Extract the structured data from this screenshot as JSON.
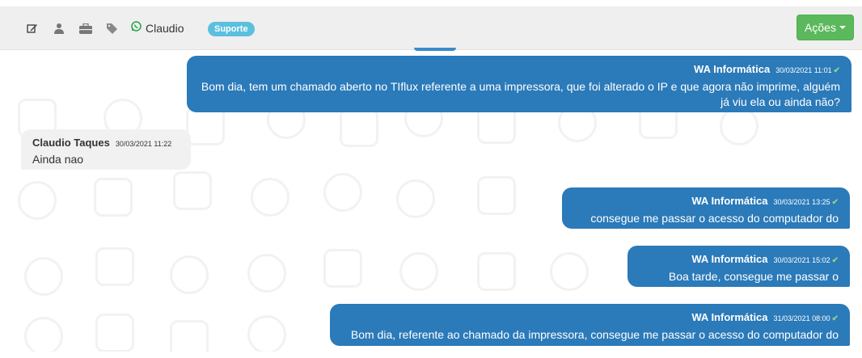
{
  "header": {
    "contact_name": "Claudio",
    "badge": "Suporte",
    "actions_label": "Ações",
    "icons": [
      "edit-icon",
      "user-icon",
      "briefcase-icon",
      "tag-icon",
      "whatsapp-icon"
    ]
  },
  "messages": [
    {
      "direction": "out",
      "sender": "WA Informática",
      "timestamp": "30/03/2021 11:01",
      "text": "Bom dia, tem um chamado aberto no TIflux referente a uma impressora, que foi alterado o IP e que agora não imprime, alguém já viu ela ou ainda não?"
    },
    {
      "direction": "in",
      "sender": "Claudio Taques",
      "timestamp": "30/03/2021 11:22",
      "text": "Ainda nao"
    },
    {
      "direction": "out",
      "sender": "WA Informática",
      "timestamp": "30/03/2021 13:25",
      "text": "consegue me passar o acesso do computador do helio?"
    },
    {
      "direction": "out",
      "sender": "WA Informática",
      "timestamp": "30/03/2021 15:02",
      "text": "Boa tarde, consegue me passar o acesso?"
    },
    {
      "direction": "out",
      "sender": "WA Informática",
      "timestamp": "31/03/2021 08:00",
      "text": "Bom dia, referente ao chamado da impressora, consegue me passar o acesso do computador do Helio?"
    }
  ],
  "colors": {
    "outgoing": "#2b7ab9",
    "incoming": "#f1f1f1",
    "action_button": "#5cb85c",
    "badge": "#5bc0de",
    "whatsapp": "#25a244"
  }
}
